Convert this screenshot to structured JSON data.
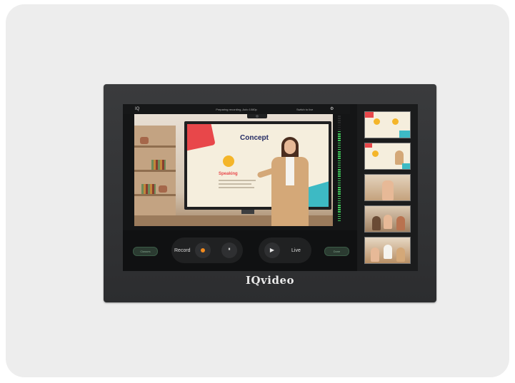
{
  "brand": "IQvideo",
  "screen": {
    "app_icon": "IQ",
    "center_text": "Preparing recording, Auto 1080p",
    "right_text": "Switch to live",
    "gear_icon": "gear-icon"
  },
  "slide": {
    "title": "Concept",
    "subtitle": "Speaking"
  },
  "controls": {
    "left_button": "Classes",
    "right_button": "Done",
    "record_label": "Record",
    "live_label": "Live",
    "pause_glyph": "⏸",
    "play_glyph": "▶"
  },
  "colors": {
    "record_accent": "#f08a1e",
    "meter_green": "#3ec85a",
    "pill_green": "#2b3b31"
  },
  "meter": {
    "level": 0.85
  }
}
